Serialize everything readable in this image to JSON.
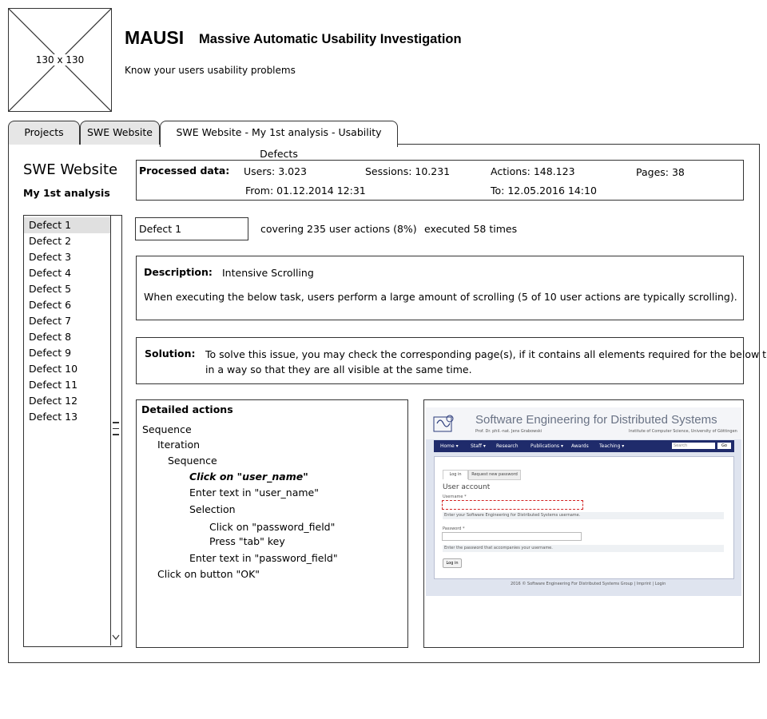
{
  "logo": {
    "placeholder_label": "130 x 130"
  },
  "header": {
    "app_name": "MAUSI",
    "app_full_name": "Massive Automatic Usability Investigation",
    "tagline": "Know your users usability problems"
  },
  "tabs": [
    {
      "label": "Projects"
    },
    {
      "label": "SWE Website"
    },
    {
      "label": "SWE Website - My 1st analysis - Usability Defects"
    }
  ],
  "project": {
    "title": "SWE Website",
    "analysis": "My 1st analysis"
  },
  "processed": {
    "label": "Processed data:",
    "users": "Users: 3.023",
    "sessions": "Sessions: 10.231",
    "actions": "Actions: 148.123",
    "pages": "Pages: 38",
    "from": "From: 01.12.2014 12:31",
    "to": "To: 12.05.2016 14:10"
  },
  "defects": [
    "Defect 1",
    "Defect 2",
    "Defect 3",
    "Defect 4",
    "Defect 5",
    "Defect 6",
    "Defect 7",
    "Defect 8",
    "Defect 9",
    "Defect 10",
    "Defect 11",
    "Defect 12",
    "Defect 13"
  ],
  "selected_defect": {
    "name": "Defect 1",
    "coverage": "covering 235 user actions (8%)",
    "executed": "executed 58 times"
  },
  "description": {
    "label": "Description:",
    "title": "Intensive Scrolling",
    "text": "When executing the below task, users perform a large amount of scrolling (5 of 10 user actions are typically scrolling)."
  },
  "solution": {
    "label": "Solution:",
    "line1": "To solve this issue, you may check the corresponding page(s), if it contains all elements required for the below task",
    "line2": "in a way so that they are all visible at the same time."
  },
  "detailed_actions": {
    "title": "Detailed actions",
    "items": [
      "Sequence",
      "Iteration",
      "Sequence",
      "Click on \"user_name\"",
      "Enter text in \"user_name\"",
      "Selection",
      "Click on \"password_field\"",
      "Press \"tab\" key",
      "Enter text in \"password_field\"",
      "Click on button \"OK\""
    ]
  },
  "site_preview": {
    "site_title": "Software Engineering for Distributed Systems",
    "site_subtitle_left": "Prof. Dr. phil.-nat. Jens Grabowski",
    "site_subtitle_right": "Institute of Computer Science, University of Göttingen",
    "nav": [
      "Home ▾",
      "Staff ▾",
      "Research",
      "Publications ▾",
      "Awards",
      "Teaching ▾"
    ],
    "search_placeholder": "Search",
    "search_button": "Go",
    "tab_login": "Log in",
    "tab_request": "Request new password",
    "heading": "User account",
    "username_label": "Username *",
    "username_help": "Enter your Software Engineering for Distributed Systems username.",
    "password_label": "Password *",
    "password_help": "Enter the password that accompanies your username.",
    "login_button": "Log in",
    "footer": "2016 © Software Engineering For Distributed Systems Group  |  Imprint  |  Login"
  },
  "colors": {
    "nav_bg": "#1f2b6b",
    "selection_bg": "#e0e0e0",
    "invalid_border": "#d22222"
  }
}
